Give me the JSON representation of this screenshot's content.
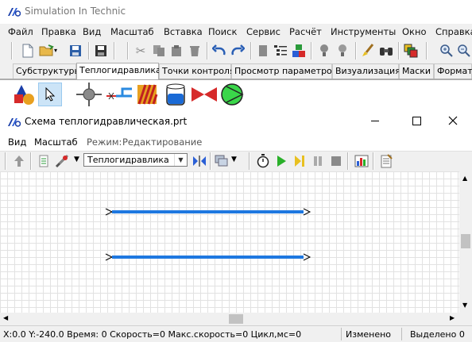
{
  "app": {
    "title": "Simulation In Technic"
  },
  "menu": [
    "Файл",
    "Правка",
    "Вид",
    "Масштаб",
    "Вставка",
    "Поиск",
    "Сервис",
    "Расчёт",
    "Инструменты",
    "Окно",
    "Справка"
  ],
  "toolbar_icons": [
    "new-file-icon",
    "open-folder-icon",
    "save-icon",
    "save-all-icon",
    "cut-icon",
    "copy-icon",
    "paste-icon",
    "delete-icon",
    "undo-icon",
    "redo-icon",
    "copy-doc-icon",
    "properties-icon",
    "components-icon",
    "bulb-off-icon",
    "bulb-dim-icon",
    "brush-icon",
    "binoculars-icon",
    "windows-icon",
    "zoom-in-icon",
    "zoom-out-icon"
  ],
  "tabs": [
    "Субструктуры",
    "Теплогидравлика",
    "Точки контроля",
    "Просмотр параметров",
    "Визуализация",
    "Маски",
    "Формат"
  ],
  "active_tab": "Теплогидравлика",
  "palette_icons": [
    "shapes-icon",
    "pointer-icon",
    "junction-icon",
    "pipe-break-icon",
    "heat-wall-icon",
    "tank-icon",
    "valve-icon",
    "pump-icon"
  ],
  "child": {
    "title": "Схема теплогидравлическая.prt",
    "menu": {
      "view": "Вид",
      "scale": "Масштаб",
      "mode_label": "Режим:",
      "mode_value": "Редактирование"
    },
    "combo_value": "Теплогидравлика",
    "toolbar_icons": [
      "up-arrow-icon",
      "page-icon",
      "tools-icon",
      "dropdown-icon",
      "connect-icon",
      "layers-icon",
      "stopwatch-icon",
      "play-icon",
      "step-icon",
      "pause-icon",
      "stop-icon",
      "chart-icon",
      "report-icon"
    ]
  },
  "pipe_color": "#1e78e0",
  "status": {
    "coords": "X:0.0  Y:-240.0 Время: 0 Скорость=0 Макс.скорость=0 Цикл,мс=0",
    "modified": "Изменено",
    "selected": "Выделено 0"
  }
}
